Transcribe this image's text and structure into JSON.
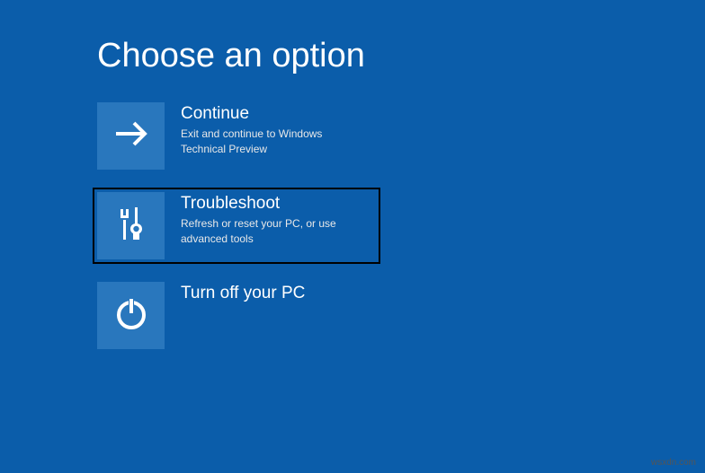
{
  "title": "Choose an option",
  "options": [
    {
      "icon": "arrow-right-icon",
      "title": "Continue",
      "desc": "Exit and continue to Windows Technical Preview"
    },
    {
      "icon": "tools-icon",
      "title": "Troubleshoot",
      "desc": "Refresh or reset your PC, or use advanced tools"
    },
    {
      "icon": "power-icon",
      "title": "Turn off your PC",
      "desc": ""
    }
  ],
  "watermark": "wsxdn.com"
}
